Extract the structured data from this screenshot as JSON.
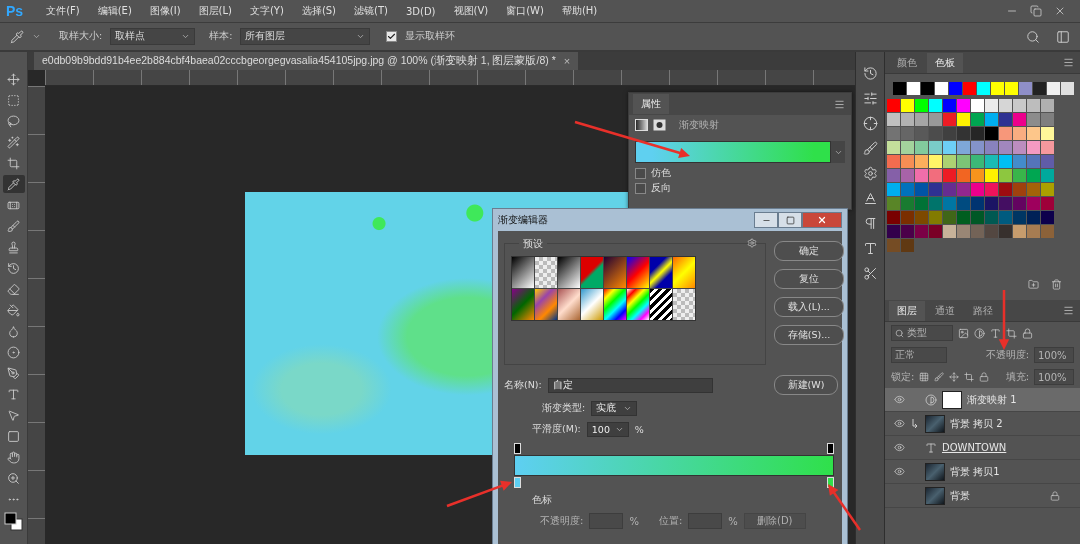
{
  "app": {
    "logo": "Ps"
  },
  "menu": [
    "文件(F)",
    "编辑(E)",
    "图像(I)",
    "图层(L)",
    "文字(Y)",
    "选择(S)",
    "滤镜(T)",
    "3D(D)",
    "视图(V)",
    "窗口(W)",
    "帮助(H)"
  ],
  "options_bar": {
    "sample_size_label": "取样大小:",
    "sample_size": "取样点",
    "sample_label": "样本:",
    "sample": "所有图层",
    "show_ring": {
      "label": "显示取样环",
      "checked": true
    }
  },
  "document_tab": {
    "title": "e0db09b9bdd91b4ee2b884cbf4baea02cccbgeorgegvasalia454105jpg.jpg @ 100% (渐变映射 1, 图层蒙版/8) *",
    "close": "×"
  },
  "properties": {
    "tab": "属性",
    "title": "渐变映射",
    "gradient": [
      {
        "color": "#5fd0f0"
      },
      {
        "color": "#2fe04a"
      }
    ],
    "options": [
      {
        "label": "仿色",
        "checked": false
      },
      {
        "label": "反向",
        "checked": false
      }
    ]
  },
  "gradient_editor": {
    "title": "渐变编辑器",
    "presets_label": "预设",
    "buttons": [
      "确定",
      "复位",
      "载入(L)...",
      "存储(S)..."
    ],
    "name_label": "名称(N):",
    "name": "自定",
    "new_button": "新建(W)",
    "type_label": "渐变类型:",
    "type": "实底",
    "smoothness_label": "平滑度(M):",
    "smoothness": "100",
    "percent": "%",
    "color_stops": [
      {
        "color": "#5ecff2"
      },
      {
        "color": "#2fe04a"
      }
    ],
    "stops_label": "色标",
    "opacity_label": "不透明度:",
    "position_label": "位置:",
    "delete_button": "删除(D)"
  },
  "swatches_panel": {
    "tabs": [
      {
        "label": "颜色",
        "selected": false
      },
      {
        "label": "色板",
        "selected": true
      }
    ],
    "recent": [
      {
        "color": "#000000"
      },
      {
        "color": "#ffffff"
      },
      {
        "color": "#000000"
      },
      {
        "color": "#ffffff"
      },
      {
        "color": "#0000ff"
      },
      {
        "color": "#ff0000"
      },
      {
        "color": "#00ffff"
      },
      {
        "color": "#ffff00"
      },
      {
        "color": "#ffff00"
      },
      {
        "color": "#8f8fc8"
      },
      {
        "color": "#222222"
      },
      {
        "color": "#f0f0f0"
      },
      {
        "color": "#e0e0e0"
      }
    ],
    "swatches": [
      {
        "color": "#ff0000"
      },
      {
        "color": "#ffff00"
      },
      {
        "color": "#00ff00"
      },
      {
        "color": "#00ffff"
      },
      {
        "color": "#0000ff"
      },
      {
        "color": "#ff00ff"
      },
      {
        "color": "#ffffff"
      },
      {
        "color": "#ebebeb"
      },
      {
        "color": "#d6d6d6"
      },
      {
        "color": "#c9c9c9"
      },
      {
        "color": "#bdbdbd"
      },
      {
        "color": "#b0b0b0"
      },
      {
        "color": "#c0c0c0"
      },
      {
        "color": "#b2b2b2"
      },
      {
        "color": "#a5a5a5"
      },
      {
        "color": "#989898"
      },
      {
        "color": "#ed1c24"
      },
      {
        "color": "#fff200"
      },
      {
        "color": "#00a651"
      },
      {
        "color": "#00aeef"
      },
      {
        "color": "#2e3192"
      },
      {
        "color": "#ec008c"
      },
      {
        "color": "#8c8c8c"
      },
      {
        "color": "#7f7f7f"
      },
      {
        "color": "#737373"
      },
      {
        "color": "#666666"
      },
      {
        "color": "#595959"
      },
      {
        "color": "#4c4c4c"
      },
      {
        "color": "#404040"
      },
      {
        "color": "#333333"
      },
      {
        "color": "#262626"
      },
      {
        "color": "#000000"
      },
      {
        "color": "#f7977a"
      },
      {
        "color": "#f9ad81"
      },
      {
        "color": "#fdc68a"
      },
      {
        "color": "#fff79a"
      },
      {
        "color": "#c4df9b"
      },
      {
        "color": "#a3d39c"
      },
      {
        "color": "#82ca9d"
      },
      {
        "color": "#7accc8"
      },
      {
        "color": "#6dcff6"
      },
      {
        "color": "#7ea7d8"
      },
      {
        "color": "#8493ca"
      },
      {
        "color": "#8882be"
      },
      {
        "color": "#a187be"
      },
      {
        "color": "#bc8dbf"
      },
      {
        "color": "#f49ac2"
      },
      {
        "color": "#f6989d"
      },
      {
        "color": "#f26c4f"
      },
      {
        "color": "#f68e55"
      },
      {
        "color": "#fbaf5c"
      },
      {
        "color": "#fff467"
      },
      {
        "color": "#acd372"
      },
      {
        "color": "#7cc576"
      },
      {
        "color": "#3bb878"
      },
      {
        "color": "#1abbb4"
      },
      {
        "color": "#00bff3"
      },
      {
        "color": "#438ccb"
      },
      {
        "color": "#5574b9"
      },
      {
        "color": "#605ca8"
      },
      {
        "color": "#8560a8"
      },
      {
        "color": "#a763a8"
      },
      {
        "color": "#f06eaa"
      },
      {
        "color": "#f26d7d"
      },
      {
        "color": "#ed1c24"
      },
      {
        "color": "#f26522"
      },
      {
        "color": "#f7941d"
      },
      {
        "color": "#fff200"
      },
      {
        "color": "#8dc73f"
      },
      {
        "color": "#39b54a"
      },
      {
        "color": "#00a651"
      },
      {
        "color": "#00a99d"
      },
      {
        "color": "#00aeef"
      },
      {
        "color": "#0072bc"
      },
      {
        "color": "#0054a6"
      },
      {
        "color": "#2e3192"
      },
      {
        "color": "#662d91"
      },
      {
        "color": "#92278f"
      },
      {
        "color": "#ec008c"
      },
      {
        "color": "#ed145b"
      },
      {
        "color": "#9e0b0f"
      },
      {
        "color": "#a0410d"
      },
      {
        "color": "#a36209"
      },
      {
        "color": "#aba000"
      },
      {
        "color": "#598527"
      },
      {
        "color": "#197b30"
      },
      {
        "color": "#007236"
      },
      {
        "color": "#00746b"
      },
      {
        "color": "#0076a3"
      },
      {
        "color": "#004b80"
      },
      {
        "color": "#003471"
      },
      {
        "color": "#1b1464"
      },
      {
        "color": "#440e62"
      },
      {
        "color": "#630460"
      },
      {
        "color": "#9e005d"
      },
      {
        "color": "#9e0039"
      },
      {
        "color": "#790000"
      },
      {
        "color": "#7b2e00"
      },
      {
        "color": "#7d4900"
      },
      {
        "color": "#827b00"
      },
      {
        "color": "#406618"
      },
      {
        "color": "#005e20"
      },
      {
        "color": "#005826"
      },
      {
        "color": "#005952"
      },
      {
        "color": "#005b7f"
      },
      {
        "color": "#003663"
      },
      {
        "color": "#002157"
      },
      {
        "color": "#0d004c"
      },
      {
        "color": "#32004b"
      },
      {
        "color": "#4b0049"
      },
      {
        "color": "#7b0046"
      },
      {
        "color": "#7a0026"
      },
      {
        "color": "#c7b299"
      },
      {
        "color": "#998675"
      },
      {
        "color": "#736357"
      },
      {
        "color": "#534741"
      },
      {
        "color": "#37302d"
      },
      {
        "color": "#c69c6d"
      },
      {
        "color": "#a67c52"
      },
      {
        "color": "#8c6239"
      },
      {
        "color": "#754c24"
      },
      {
        "color": "#603913"
      }
    ]
  },
  "layers_panel": {
    "tabs": [
      {
        "label": "图层",
        "selected": true
      },
      {
        "label": "通道",
        "selected": false
      },
      {
        "label": "路径",
        "selected": false
      }
    ],
    "filter": "类型",
    "blend_mode": "正常",
    "opacity_label": "不透明度:",
    "opacity": "100%",
    "lock_label": "锁定:",
    "fill_label": "填充:",
    "fill": "100%",
    "layers": [
      {
        "name": "渐变映射 1",
        "kind": "adjustment",
        "visible": true,
        "selected": true,
        "clipped": false,
        "locked": false
      },
      {
        "name": "背景 拷贝 2",
        "kind": "image",
        "visible": true,
        "selected": false,
        "clipped": true,
        "locked": false
      },
      {
        "name": "DOWNTOWN",
        "kind": "text",
        "visible": true,
        "selected": false,
        "clipped": false,
        "locked": false
      },
      {
        "name": "背景 拷贝1",
        "kind": "image",
        "visible": true,
        "selected": false,
        "clipped": false,
        "locked": false
      },
      {
        "name": "背景",
        "kind": "image",
        "visible": false,
        "selected": false,
        "clipped": false,
        "locked": true
      }
    ]
  }
}
